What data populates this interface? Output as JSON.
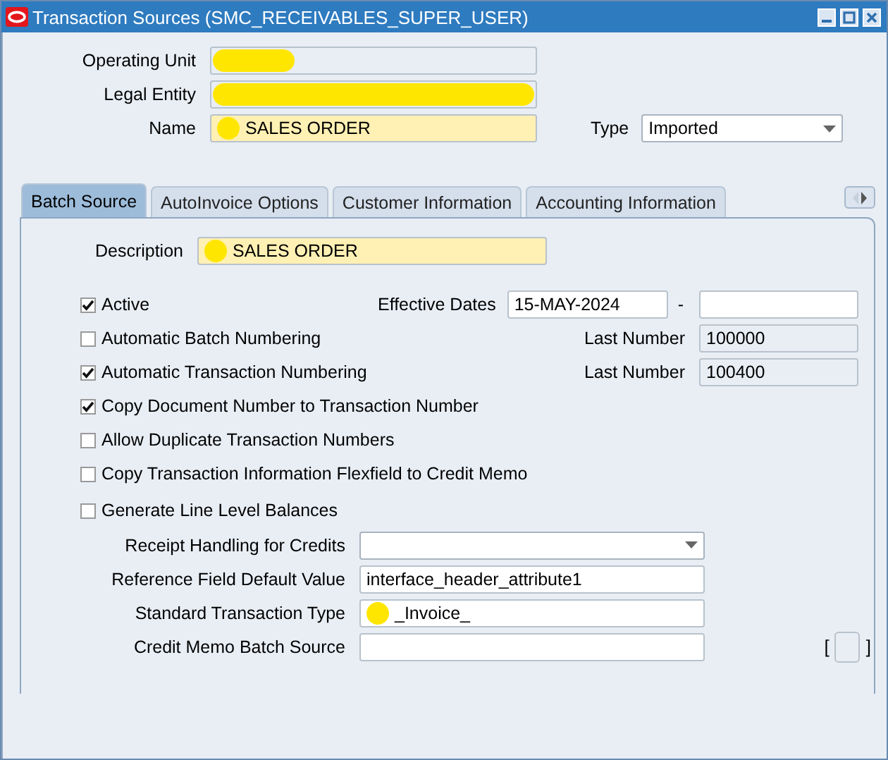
{
  "window": {
    "title": "Transaction Sources (SMC_RECEIVABLES_SUPER_USER)"
  },
  "header_fields": [
    {
      "label": "Operating Unit",
      "required": false,
      "redacted": true
    },
    {
      "label": "Legal Entity",
      "required": false,
      "redacted": true
    },
    {
      "label": "Name",
      "value": "SALES ORDER",
      "required": true,
      "redacted": true
    }
  ],
  "type_field": {
    "label": "Type",
    "value": "Imported"
  },
  "tabs": [
    {
      "label": "Batch Source",
      "selected": true
    },
    {
      "label": "AutoInvoice Options",
      "selected": false
    },
    {
      "label": "Customer Information",
      "selected": false
    },
    {
      "label": "Accounting Information",
      "selected": false
    }
  ],
  "description": {
    "label": "Description",
    "value": "SALES ORDER",
    "required": true,
    "redacted": true
  },
  "options": [
    {
      "label": "Active",
      "checked": true,
      "side": {
        "kind": "dates",
        "label": "Effective Dates",
        "start": "15-MAY-2024",
        "separator": "-"
      }
    },
    {
      "label": "Automatic Batch Numbering",
      "checked": false,
      "side": {
        "kind": "readonly",
        "label": "Last Number",
        "value": "100000"
      }
    },
    {
      "label": "Automatic Transaction Numbering",
      "checked": true,
      "side": {
        "kind": "readonly",
        "label": "Last Number",
        "value": "100400"
      }
    },
    {
      "label": "Copy Document Number to Transaction Number",
      "checked": true
    },
    {
      "label": "Allow Duplicate Transaction Numbers",
      "checked": false
    },
    {
      "label": "Copy Transaction Information Flexfield to Credit Memo",
      "checked": false
    },
    {
      "label": "Generate Line Level Balances",
      "checked": false
    }
  ],
  "bottom_fields": [
    {
      "label": "Receipt Handling for Credits",
      "kind": "dropdown"
    },
    {
      "label": "Reference Field Default Value",
      "kind": "text",
      "value": "interface_header_attribute1"
    },
    {
      "label": "Standard Transaction Type",
      "kind": "text",
      "value": "_Invoice_",
      "redacted": true
    },
    {
      "label": "Credit Memo Batch Source",
      "kind": "text"
    }
  ],
  "flexfield": {
    "open": "[",
    "close": "]"
  }
}
